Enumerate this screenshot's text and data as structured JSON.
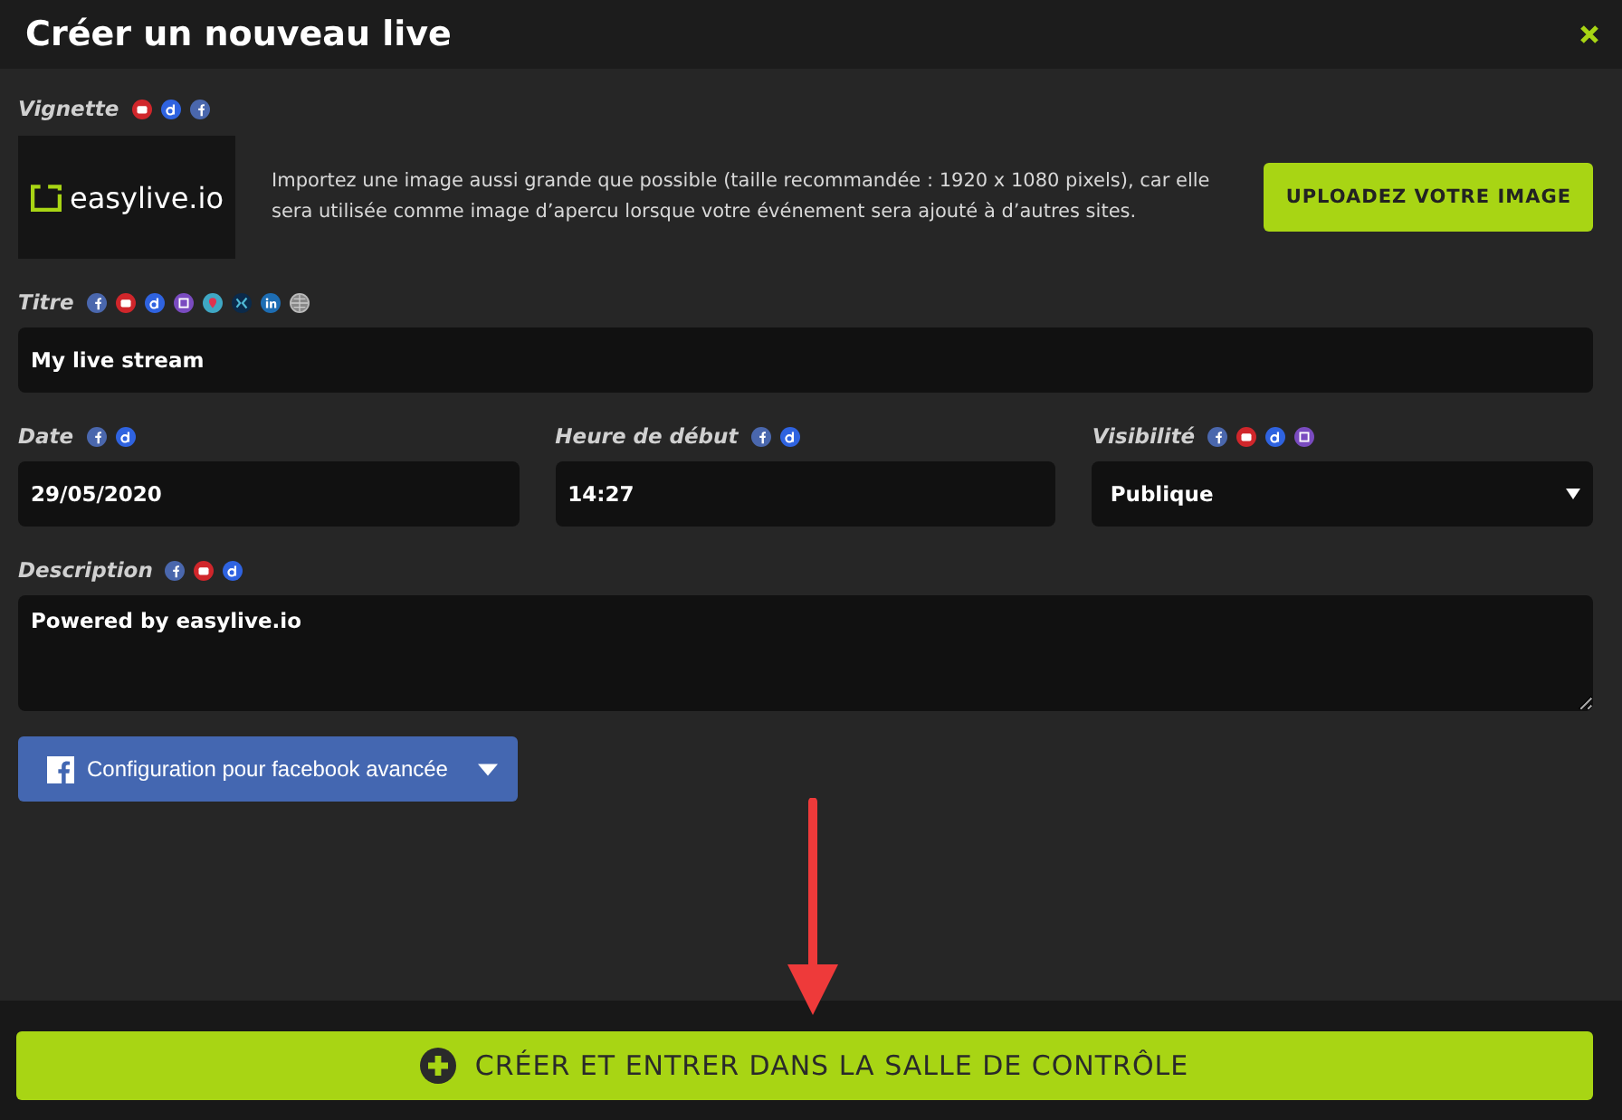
{
  "window": {
    "title": "Créer un nouveau live"
  },
  "thumbnail": {
    "label": "Vignette",
    "badges": [
      {
        "kind": "youtube"
      },
      {
        "kind": "dailymotion"
      },
      {
        "kind": "facebook"
      }
    ],
    "logo_text": "easylive.io",
    "hint": "Importez une image aussi grande que possible (taille recommandée : 1920 x 1080 pixels), car elle sera utilisée comme image d’apercu lorsque votre événement sera ajouté à d’autres sites.",
    "upload_button": "UPLOADEZ VOTRE IMAGE"
  },
  "title_field": {
    "label": "Titre",
    "badges": [
      {
        "kind": "facebook"
      },
      {
        "kind": "youtube"
      },
      {
        "kind": "dailymotion"
      },
      {
        "kind": "twitch"
      },
      {
        "kind": "periscope"
      },
      {
        "kind": "xing"
      },
      {
        "kind": "linkedin"
      },
      {
        "kind": "web"
      }
    ],
    "value": "My live stream"
  },
  "row_fields": [
    {
      "kind": "input",
      "label": "Date",
      "badges": [
        {
          "kind": "facebook"
        },
        {
          "kind": "dailymotion"
        }
      ],
      "value": "29/05/2020"
    },
    {
      "kind": "input",
      "label": "Heure de début",
      "badges": [
        {
          "kind": "facebook"
        },
        {
          "kind": "dailymotion"
        }
      ],
      "value": "14:27"
    },
    {
      "kind": "select",
      "label": "Visibilité",
      "badges": [
        {
          "kind": "facebook"
        },
        {
          "kind": "youtube"
        },
        {
          "kind": "dailymotion"
        },
        {
          "kind": "twitch"
        }
      ],
      "value": "Publique"
    }
  ],
  "description": {
    "label": "Description",
    "badges": [
      {
        "kind": "facebook"
      },
      {
        "kind": "youtube"
      },
      {
        "kind": "dailymotion"
      }
    ],
    "value": "Powered by easylive.io"
  },
  "facebook_config": {
    "label": "Configuration pour facebook avancée",
    "expanded": false
  },
  "submit_button": "CRÉER ET ENTRER DANS LA SALLE DE CONTRÔLE"
}
